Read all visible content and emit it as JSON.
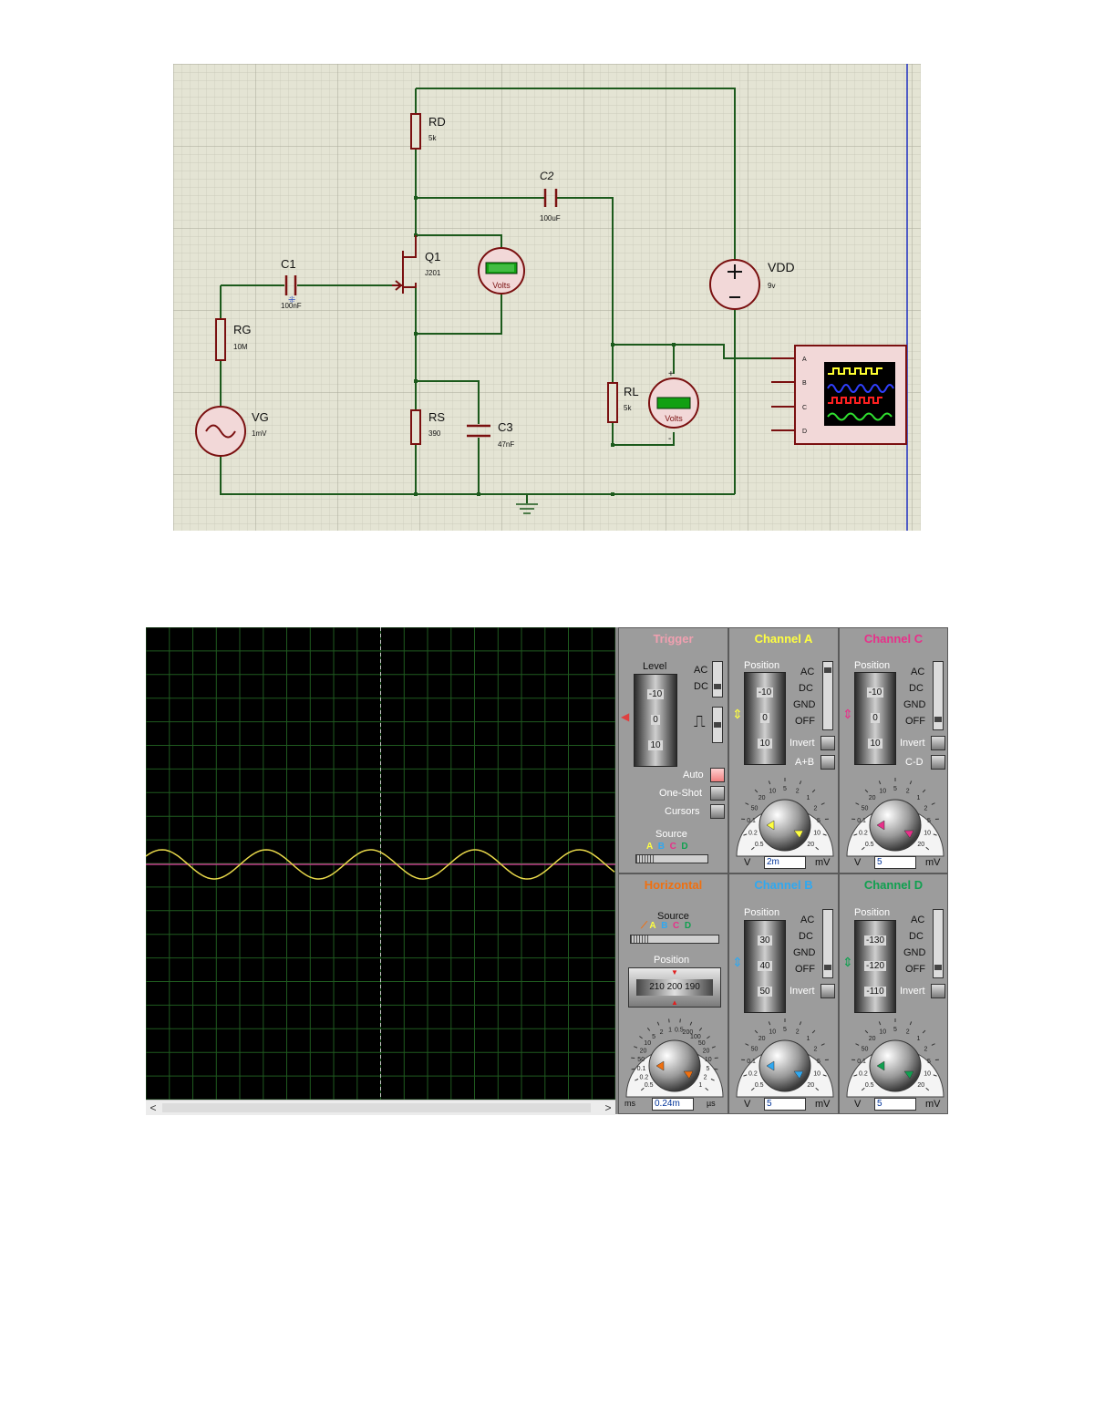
{
  "schematic": {
    "components": {
      "rd": {
        "name": "RD",
        "value": "5k"
      },
      "c2": {
        "name": "C2",
        "value": "100uF"
      },
      "q1": {
        "name": "Q1",
        "value": "J201"
      },
      "c1": {
        "name": "C1",
        "value": "100nF"
      },
      "rg": {
        "name": "RG",
        "value": "10M"
      },
      "vg": {
        "name": "VG",
        "value": "1mV"
      },
      "rs": {
        "name": "RS",
        "value": "390"
      },
      "c3": {
        "name": "C3",
        "value": "47nF"
      },
      "rl": {
        "name": "RL",
        "value": "5k"
      },
      "vdd": {
        "name": "VDD",
        "value": "9v"
      }
    },
    "voltmeter1": {
      "label": "Volts",
      "plus": "+",
      "minus": "-"
    },
    "voltmeter2": {
      "label": "Volts",
      "plus": "+",
      "minus": "-"
    },
    "scope_pins": [
      "A",
      "B",
      "C",
      "D"
    ]
  },
  "oscilloscope": {
    "trigger": {
      "title": "Trigger",
      "level_label": "Level",
      "ticks": [
        "-10",
        "0",
        "10"
      ],
      "ac": "AC",
      "dc": "DC",
      "auto": "Auto",
      "one_shot": "One-Shot",
      "cursors": "Cursors",
      "source_label": "Source",
      "sources": [
        "A",
        "B",
        "C",
        "D"
      ]
    },
    "channel_a": {
      "title": "Channel A",
      "position_label": "Position",
      "ticks": [
        "-10",
        "0",
        "10"
      ],
      "ac": "AC",
      "dc": "DC",
      "gnd": "GND",
      "off": "OFF",
      "invert": "Invert",
      "extra": "A+B",
      "dial_labels": [
        "0.5",
        "0.2",
        "0.1",
        "50",
        "20",
        "10",
        "5",
        "2",
        "1",
        "2",
        "5",
        "10",
        "20"
      ],
      "unit_left": "V",
      "unit_right": "mV",
      "value": "2m"
    },
    "channel_c": {
      "title": "Channel C",
      "position_label": "Position",
      "ticks": [
        "-10",
        "0",
        "10"
      ],
      "ac": "AC",
      "dc": "DC",
      "gnd": "GND",
      "off": "OFF",
      "invert": "Invert",
      "extra": "C-D",
      "dial_labels": [
        "0.5",
        "0.2",
        "0.1",
        "50",
        "20",
        "10",
        "5",
        "2",
        "1",
        "2",
        "5",
        "10",
        "20"
      ],
      "unit_left": "V",
      "unit_right": "mV",
      "value": "5"
    },
    "horizontal": {
      "title": "Horizontal",
      "source_label": "Source",
      "sources": [
        "A",
        "B",
        "C",
        "D"
      ],
      "position_label": "Position",
      "position_ticks": [
        "210",
        "200",
        "190"
      ],
      "dial_labels": [
        "0.5",
        "0.2",
        "0.1",
        "50",
        "20",
        "10",
        "5",
        "2",
        "1",
        "0.5",
        "200",
        "100",
        "50",
        "20",
        "10",
        "5",
        "2",
        "1"
      ],
      "unit_left": "ms",
      "unit_right": "µs",
      "value": "0.24m"
    },
    "channel_b": {
      "title": "Channel B",
      "position_label": "Position",
      "ticks": [
        "30",
        "40",
        "50"
      ],
      "ac": "AC",
      "dc": "DC",
      "gnd": "GND",
      "off": "OFF",
      "invert": "Invert",
      "dial_labels": [
        "0.5",
        "0.2",
        "0.1",
        "50",
        "20",
        "10",
        "5",
        "2",
        "1",
        "2",
        "5",
        "10",
        "20"
      ],
      "unit_left": "V",
      "unit_right": "mV",
      "value": "5"
    },
    "channel_d": {
      "title": "Channel D",
      "position_label": "Position",
      "ticks": [
        "-130",
        "-120",
        "-110"
      ],
      "ac": "AC",
      "dc": "DC",
      "gnd": "GND",
      "off": "OFF",
      "invert": "Invert",
      "dial_labels": [
        "0.5",
        "0.2",
        "0.1",
        "50",
        "20",
        "10",
        "5",
        "2",
        "1",
        "2",
        "5",
        "10",
        "20"
      ],
      "unit_left": "V",
      "unit_right": "mV",
      "value": "5"
    },
    "scroll": {
      "left": "<",
      "right": ">"
    },
    "colors": {
      "trace_a": "#e8d84a",
      "trace_c": "#e040a0",
      "title_trigger": "#f0a0b0",
      "title_a": "#ffff40",
      "title_c": "#e8308a",
      "title_h": "#f07010",
      "title_b": "#30a8f0",
      "title_d": "#10a050",
      "grid": "#1f5a1f"
    },
    "waveform": {
      "cycles_visible": 4.5
    }
  }
}
